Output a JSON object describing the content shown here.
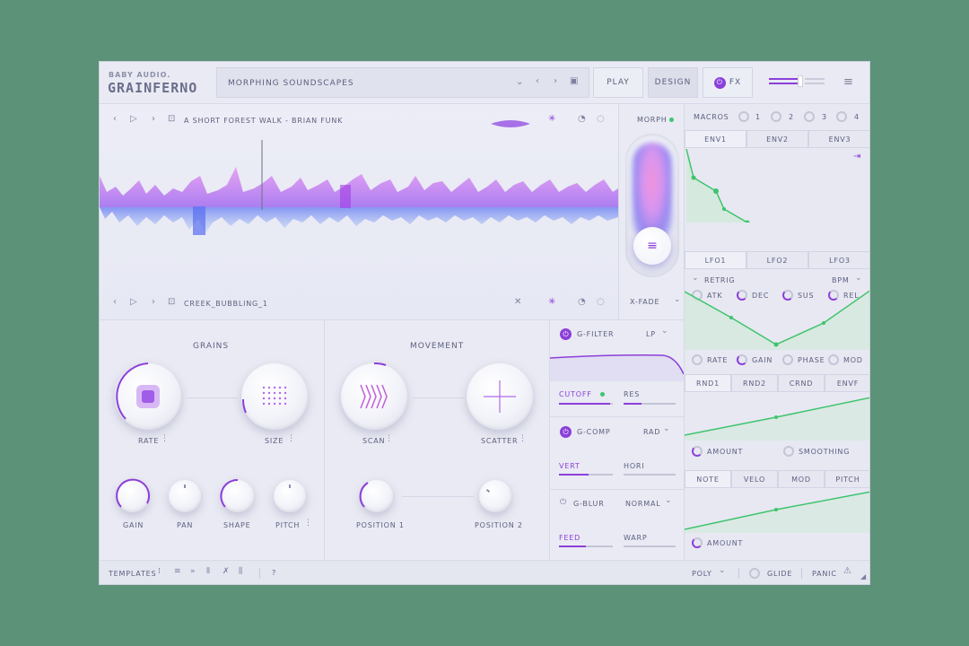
{
  "brand": {
    "maker": "BABY AUDIO.",
    "product": "GRAINFERNO"
  },
  "header": {
    "preset_name": "MORPHING SOUNDSCAPES",
    "play_label": "PLAY",
    "design_label": "DESIGN",
    "fx_label": "FX"
  },
  "sample_a": {
    "name": "A SHORT FOREST WALK - BRIAN FUNK"
  },
  "sample_b": {
    "name": "CREEK_BUBBLING_1"
  },
  "morph": {
    "label": "MORPH",
    "xfade_label": "X-FADE"
  },
  "grains": {
    "title": "GRAINS",
    "rate_label": "RATE",
    "size_label": "SIZE",
    "gain_label": "GAIN",
    "pan_label": "PAN",
    "shape_label": "SHAPE",
    "pitch_label": "PITCH"
  },
  "movement": {
    "title": "MOVEMENT",
    "scan_label": "SCAN",
    "scatter_label": "SCATTER",
    "position1_label": "POSITION 1",
    "position2_label": "POSITION 2"
  },
  "filter": {
    "label": "G-FILTER",
    "mode": "LP",
    "cutoff_label": "CUTOFF",
    "res_label": "RES",
    "cutoff_value": 0.95,
    "res_value": 0.35
  },
  "comp": {
    "label": "G-COMP",
    "mode": "RAD",
    "vert_label": "VERT",
    "hori_label": "HORI",
    "vert_value": 0.55,
    "hori_value": 0.0
  },
  "blur": {
    "label": "G-BLUR",
    "mode": "NORMAL",
    "feed_label": "FEED",
    "warp_label": "WARP",
    "feed_value": 0.5,
    "warp_value": 0.0
  },
  "macros": {
    "label": "MACROS",
    "items": [
      "1",
      "2",
      "3",
      "4"
    ]
  },
  "env": {
    "tabs": [
      "ENV1",
      "ENV2",
      "ENV3"
    ],
    "params": [
      "ATK",
      "DEC",
      "SUS",
      "REL"
    ]
  },
  "lfo": {
    "tabs": [
      "LFO1",
      "LFO2",
      "LFO3"
    ],
    "retrig_label": "RETRIG",
    "sync_label": "BPM",
    "params": [
      "RATE",
      "GAIN",
      "PHASE",
      "MOD"
    ]
  },
  "rnd": {
    "tabs": [
      "RND1",
      "RND2",
      "CRND",
      "ENVF"
    ],
    "amount_label": "AMOUNT",
    "smoothing_label": "SMOOTHING"
  },
  "note": {
    "tabs": [
      "NOTE",
      "VELO",
      "MOD",
      "PITCH"
    ],
    "amount_label": "AMOUNT"
  },
  "footer": {
    "templates_label": "TEMPLATES",
    "help": "?",
    "poly_label": "POLY",
    "glide_label": "GLIDE",
    "panic_label": "PANIC"
  },
  "colors": {
    "accent": "#8b3fd9",
    "mod_green": "#3ec46d",
    "panel": "#e9eaf3",
    "background": "#5b9278"
  }
}
